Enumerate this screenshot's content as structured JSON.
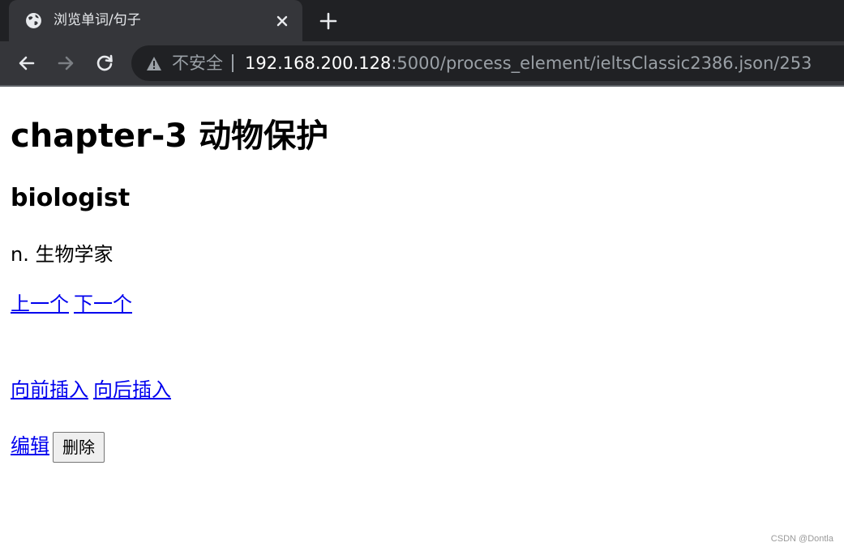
{
  "browser": {
    "tab": {
      "title": "浏览单词/句子",
      "favicon": "globe-icon"
    },
    "security_label": "不安全",
    "url_host": "192.168.200.128",
    "url_path": ":5000/process_element/ieltsClassic2386.json/253",
    "colors": {
      "tab_bar": "#202124",
      "toolbar": "#35363a",
      "omnibox": "#202124"
    }
  },
  "page": {
    "title": "chapter-3 动物保护",
    "word": "biologist",
    "definition": "n. 生物学家",
    "nav": {
      "prev": "上一个",
      "next": "下一个"
    },
    "insert": {
      "before": "向前插入",
      "after": "向后插入"
    },
    "actions": {
      "edit": "编辑",
      "delete": "删除"
    },
    "link_color": "#0000ee"
  },
  "watermark": "CSDN @Dontla"
}
